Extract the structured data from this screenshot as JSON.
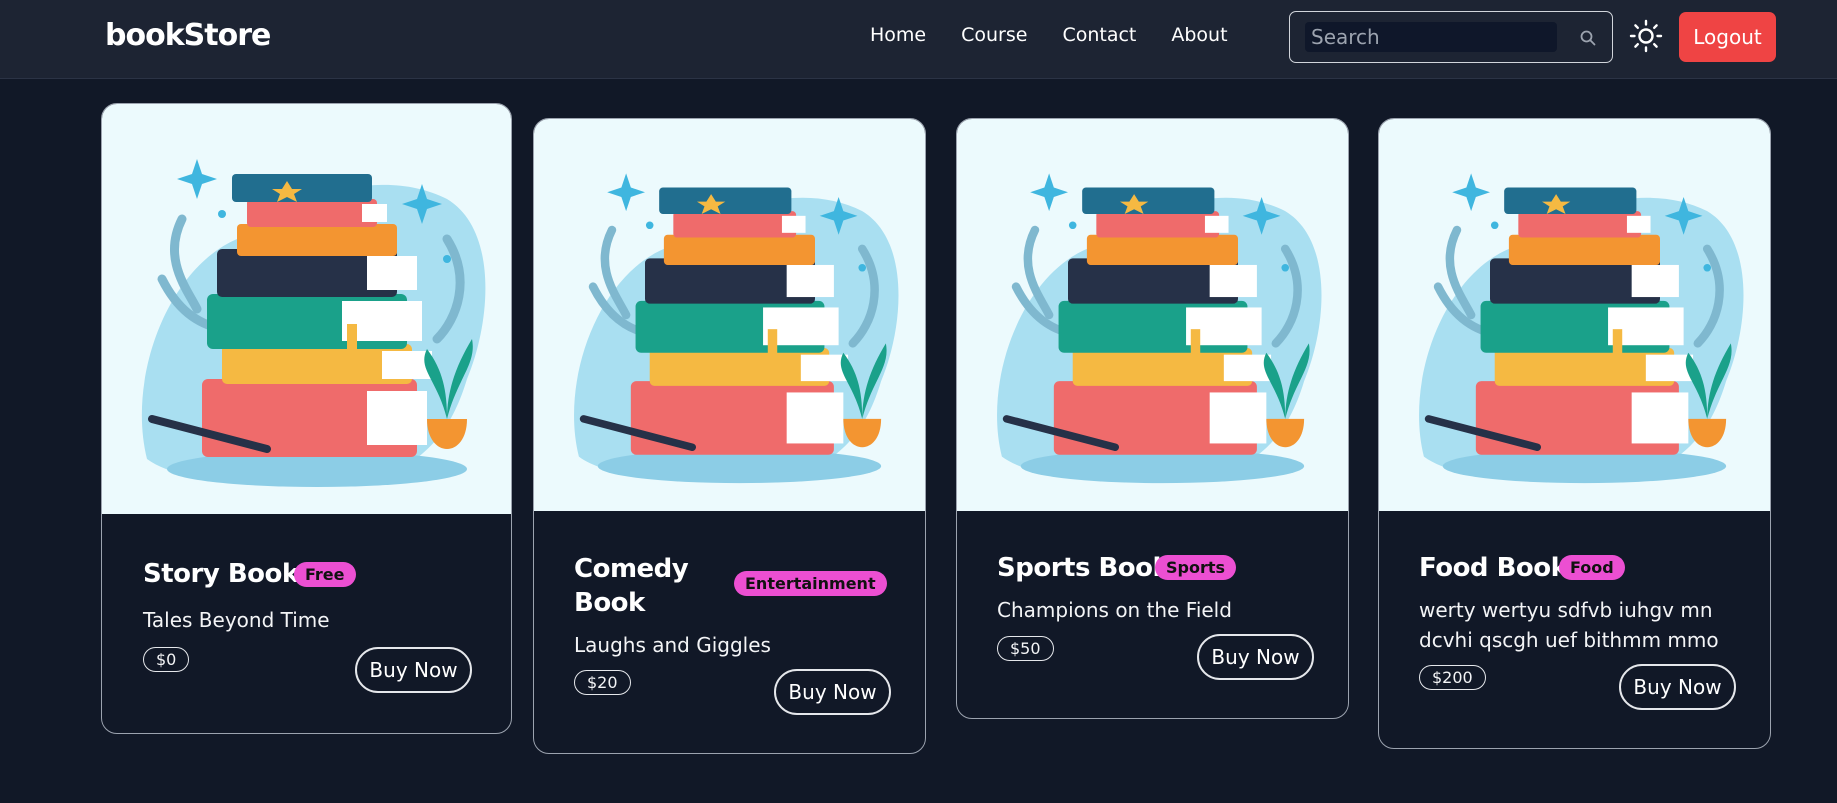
{
  "navbar": {
    "brand": "bookStore",
    "links": [
      "Home",
      "Course",
      "Contact",
      "About"
    ],
    "search_placeholder": "Search",
    "logout_label": "Logout"
  },
  "colors": {
    "background": "#111827",
    "navbar": "#1d2433",
    "logout": "#ef4444",
    "badge": "#ec4fd2",
    "image_bg": "#ecfafd"
  },
  "cards": [
    {
      "title": "Story Book",
      "badge": "Free",
      "description": "Tales Beyond Time",
      "price": "$0",
      "button": "Buy Now"
    },
    {
      "title": "Comedy Book",
      "badge": "Entertainment",
      "description": "Laughs and Giggles",
      "price": "$20",
      "button": "Buy Now"
    },
    {
      "title": "Sports Book",
      "badge": "Sports",
      "description": "Champions on the Field",
      "price": "$50",
      "button": "Buy Now"
    },
    {
      "title": "Food Book",
      "badge": "Food",
      "description": "werty wertyu sdfvb iuhgv mn dcvhi qscgh uef bithmm mmo",
      "price": "$200",
      "button": "Buy Now"
    }
  ]
}
